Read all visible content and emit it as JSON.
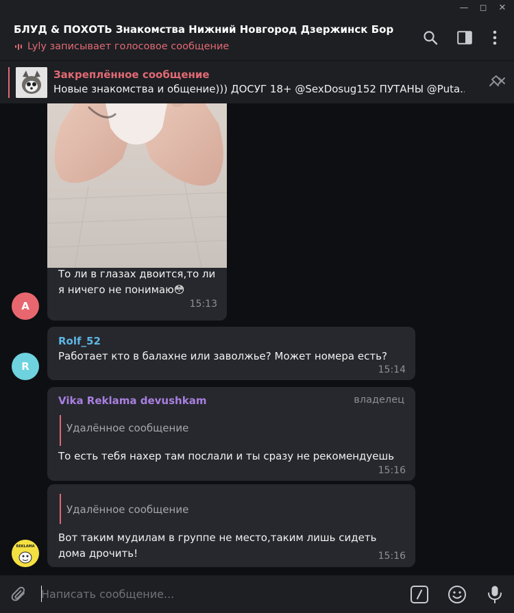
{
  "window": {
    "minimize_glyph": "—",
    "maximize_glyph": "◻",
    "close_glyph": "✕"
  },
  "header": {
    "title": "БЛУД & ПОХОТЬ Знакомства Нижний Новгород Дзержинск Бор",
    "status": "Lyly записывает голосовое сообщение",
    "icons": [
      "search-icon",
      "sidebar-toggle-icon",
      "more-vert-icon"
    ]
  },
  "pinned": {
    "title": "Закреплённое сообщение",
    "text": "Новые знакомства и общение))) ДОСУГ 18+ @SexDosug152 ПУТАНЫ @Puta...",
    "icon": "unpin-icon"
  },
  "messages": [
    {
      "type": "photo",
      "text": "То ли в глазах двоится,то ли я ничего не понимаю😳",
      "time": "15:13",
      "avatar_letter": "A",
      "avatar_color": "#e8676f"
    },
    {
      "sender": "Rolf_52",
      "sender_color": "#5fb6e6",
      "text": "Работает кто в балахне или заволжье? Может номера есть?",
      "time": "15:14",
      "avatar_letter": "R",
      "avatar_color": "#6ed3de"
    },
    {
      "sender": "Vika Reklama devushkam",
      "sender_color": "#a97fe0",
      "role": "владелец",
      "reply": "Удалённое сообщение",
      "text": "То есть тебя нахер там послали и ты сразу не рекомендуешь",
      "time": "15:16"
    },
    {
      "reply": "Удалённое сообщение",
      "text": "Вот таким мудилам в группе не место,таким лишь сидеть дома дрочить!",
      "time": "15:16",
      "avatar_text": "REKLAMA",
      "avatar_color": "#f5e042"
    }
  ],
  "composer": {
    "placeholder": "Написать сообщение...",
    "icons": [
      "attach-icon",
      "commands-icon",
      "emoji-icon",
      "microphone-icon"
    ]
  },
  "colors": {
    "accent": "#e26a73",
    "bubble": "#26282d",
    "background": "#0e0f12",
    "panel": "#1d1f23"
  }
}
